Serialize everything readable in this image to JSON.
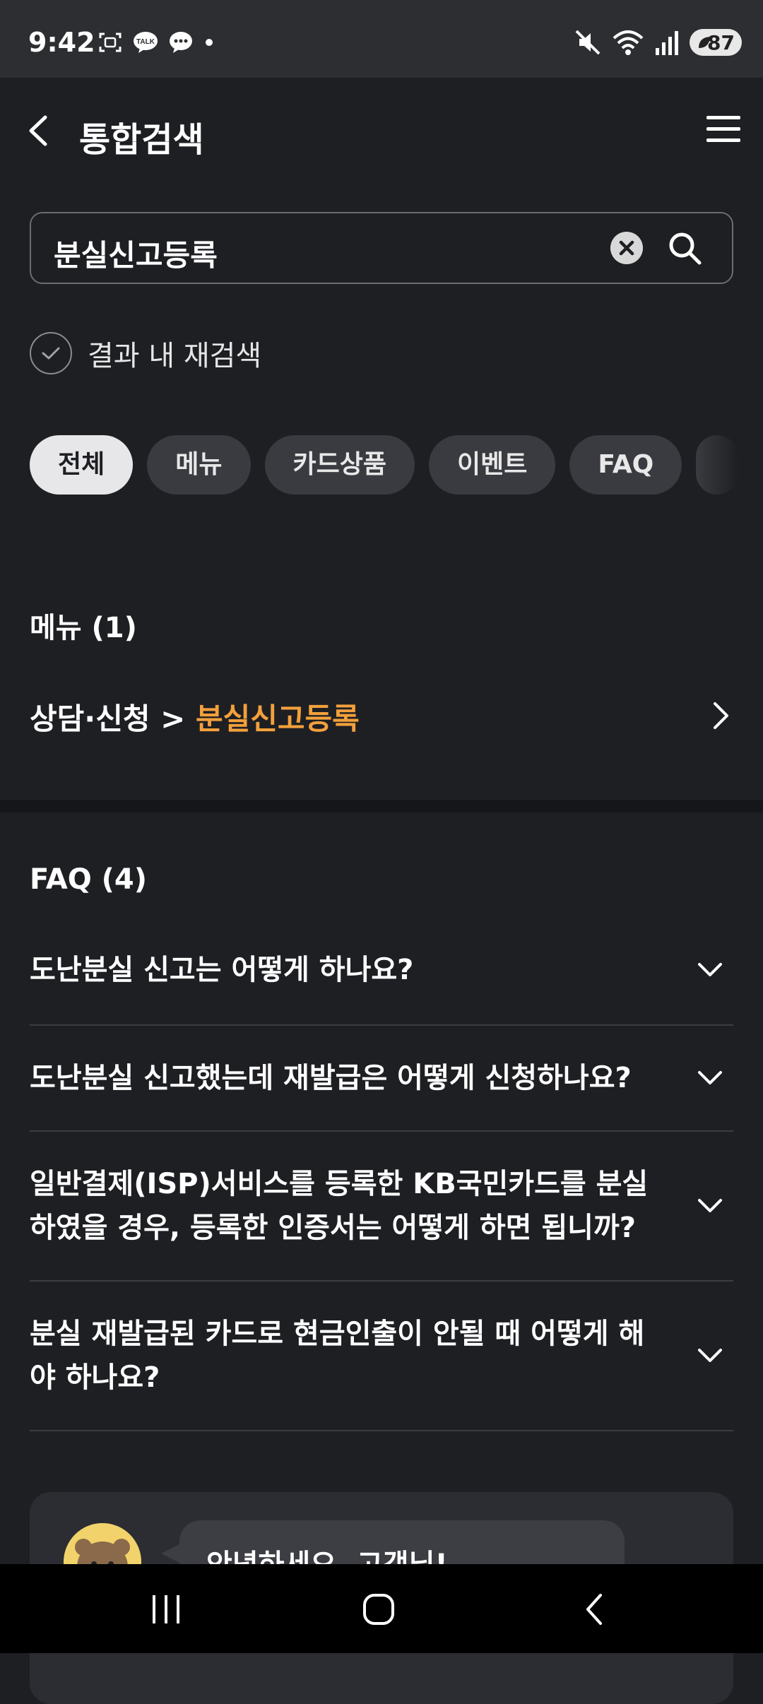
{
  "status_bar": {
    "time": "9:42",
    "battery": "87",
    "left_icons": [
      "screenshot-icon",
      "kakaotalk-icon",
      "chat-bubble-icon",
      "dot-icon"
    ],
    "right_icons": [
      "mute-icon",
      "wifi-icon",
      "signal-icon",
      "battery-icon"
    ],
    "kakaotalk_text": "TALK"
  },
  "header": {
    "title": "통합검색",
    "back_icon": "chevron-left-icon",
    "menu_icon": "hamburger-menu-icon"
  },
  "search": {
    "value": "분실신고등록",
    "clear_icon": "clear-icon",
    "search_icon": "search-icon"
  },
  "recheck": {
    "label": "결과 내 재검색",
    "checked": false
  },
  "tabs": [
    {
      "label": "전체",
      "active": true
    },
    {
      "label": "메뉴",
      "active": false
    },
    {
      "label": "카드상품",
      "active": false
    },
    {
      "label": "이벤트",
      "active": false
    },
    {
      "label": "FAQ",
      "active": false
    }
  ],
  "menu_section": {
    "title": "메뉴 (1)",
    "result": {
      "path_prefix": "상담·신청 > ",
      "highlight": "분실신고등록"
    }
  },
  "faq_section": {
    "title": "FAQ (4)",
    "items": [
      "도난분실 신고는 어떻게 하나요?",
      "도난분실 신고했는데 재발급은 어떻게 신청하나요?",
      "일반결제(ISP)서비스를 등록한 KB국민카드를 분실하였을 경우, 등록한 인증서는 어떻게 하면 됩니까?",
      "분실 재발급된 카드로 현금인출이 안될 때 어떻게 해야 하나요?"
    ]
  },
  "chat": {
    "greeting": "안녕하세요, 고객님!"
  },
  "colors": {
    "background": "#1e1f23",
    "highlight": "#f3a03c",
    "chip_active": "#e7e7e9",
    "chip_inactive": "#3a3b40"
  }
}
